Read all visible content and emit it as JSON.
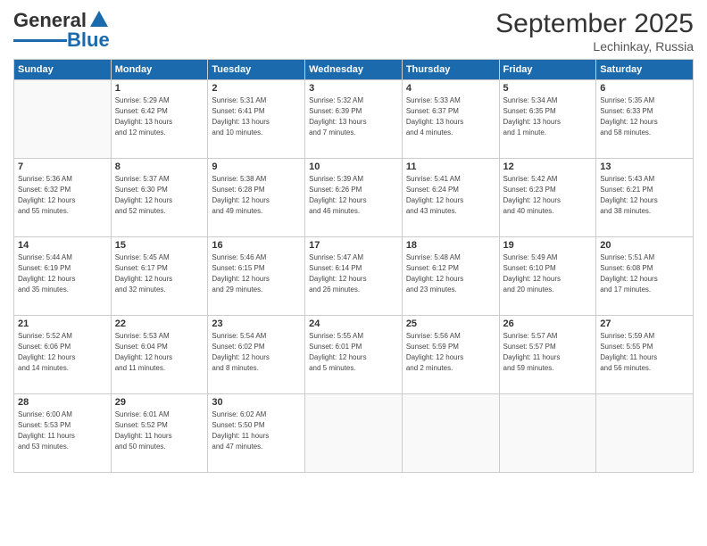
{
  "header": {
    "logo_general": "General",
    "logo_blue": "Blue",
    "month": "September 2025",
    "location": "Lechinkay, Russia"
  },
  "days_of_week": [
    "Sunday",
    "Monday",
    "Tuesday",
    "Wednesday",
    "Thursday",
    "Friday",
    "Saturday"
  ],
  "weeks": [
    [
      {
        "day": "",
        "info": ""
      },
      {
        "day": "1",
        "info": "Sunrise: 5:29 AM\nSunset: 6:42 PM\nDaylight: 13 hours\nand 12 minutes."
      },
      {
        "day": "2",
        "info": "Sunrise: 5:31 AM\nSunset: 6:41 PM\nDaylight: 13 hours\nand 10 minutes."
      },
      {
        "day": "3",
        "info": "Sunrise: 5:32 AM\nSunset: 6:39 PM\nDaylight: 13 hours\nand 7 minutes."
      },
      {
        "day": "4",
        "info": "Sunrise: 5:33 AM\nSunset: 6:37 PM\nDaylight: 13 hours\nand 4 minutes."
      },
      {
        "day": "5",
        "info": "Sunrise: 5:34 AM\nSunset: 6:35 PM\nDaylight: 13 hours\nand 1 minute."
      },
      {
        "day": "6",
        "info": "Sunrise: 5:35 AM\nSunset: 6:33 PM\nDaylight: 12 hours\nand 58 minutes."
      }
    ],
    [
      {
        "day": "7",
        "info": "Sunrise: 5:36 AM\nSunset: 6:32 PM\nDaylight: 12 hours\nand 55 minutes."
      },
      {
        "day": "8",
        "info": "Sunrise: 5:37 AM\nSunset: 6:30 PM\nDaylight: 12 hours\nand 52 minutes."
      },
      {
        "day": "9",
        "info": "Sunrise: 5:38 AM\nSunset: 6:28 PM\nDaylight: 12 hours\nand 49 minutes."
      },
      {
        "day": "10",
        "info": "Sunrise: 5:39 AM\nSunset: 6:26 PM\nDaylight: 12 hours\nand 46 minutes."
      },
      {
        "day": "11",
        "info": "Sunrise: 5:41 AM\nSunset: 6:24 PM\nDaylight: 12 hours\nand 43 minutes."
      },
      {
        "day": "12",
        "info": "Sunrise: 5:42 AM\nSunset: 6:23 PM\nDaylight: 12 hours\nand 40 minutes."
      },
      {
        "day": "13",
        "info": "Sunrise: 5:43 AM\nSunset: 6:21 PM\nDaylight: 12 hours\nand 38 minutes."
      }
    ],
    [
      {
        "day": "14",
        "info": "Sunrise: 5:44 AM\nSunset: 6:19 PM\nDaylight: 12 hours\nand 35 minutes."
      },
      {
        "day": "15",
        "info": "Sunrise: 5:45 AM\nSunset: 6:17 PM\nDaylight: 12 hours\nand 32 minutes."
      },
      {
        "day": "16",
        "info": "Sunrise: 5:46 AM\nSunset: 6:15 PM\nDaylight: 12 hours\nand 29 minutes."
      },
      {
        "day": "17",
        "info": "Sunrise: 5:47 AM\nSunset: 6:14 PM\nDaylight: 12 hours\nand 26 minutes."
      },
      {
        "day": "18",
        "info": "Sunrise: 5:48 AM\nSunset: 6:12 PM\nDaylight: 12 hours\nand 23 minutes."
      },
      {
        "day": "19",
        "info": "Sunrise: 5:49 AM\nSunset: 6:10 PM\nDaylight: 12 hours\nand 20 minutes."
      },
      {
        "day": "20",
        "info": "Sunrise: 5:51 AM\nSunset: 6:08 PM\nDaylight: 12 hours\nand 17 minutes."
      }
    ],
    [
      {
        "day": "21",
        "info": "Sunrise: 5:52 AM\nSunset: 6:06 PM\nDaylight: 12 hours\nand 14 minutes."
      },
      {
        "day": "22",
        "info": "Sunrise: 5:53 AM\nSunset: 6:04 PM\nDaylight: 12 hours\nand 11 minutes."
      },
      {
        "day": "23",
        "info": "Sunrise: 5:54 AM\nSunset: 6:02 PM\nDaylight: 12 hours\nand 8 minutes."
      },
      {
        "day": "24",
        "info": "Sunrise: 5:55 AM\nSunset: 6:01 PM\nDaylight: 12 hours\nand 5 minutes."
      },
      {
        "day": "25",
        "info": "Sunrise: 5:56 AM\nSunset: 5:59 PM\nDaylight: 12 hours\nand 2 minutes."
      },
      {
        "day": "26",
        "info": "Sunrise: 5:57 AM\nSunset: 5:57 PM\nDaylight: 11 hours\nand 59 minutes."
      },
      {
        "day": "27",
        "info": "Sunrise: 5:59 AM\nSunset: 5:55 PM\nDaylight: 11 hours\nand 56 minutes."
      }
    ],
    [
      {
        "day": "28",
        "info": "Sunrise: 6:00 AM\nSunset: 5:53 PM\nDaylight: 11 hours\nand 53 minutes."
      },
      {
        "day": "29",
        "info": "Sunrise: 6:01 AM\nSunset: 5:52 PM\nDaylight: 11 hours\nand 50 minutes."
      },
      {
        "day": "30",
        "info": "Sunrise: 6:02 AM\nSunset: 5:50 PM\nDaylight: 11 hours\nand 47 minutes."
      },
      {
        "day": "",
        "info": ""
      },
      {
        "day": "",
        "info": ""
      },
      {
        "day": "",
        "info": ""
      },
      {
        "day": "",
        "info": ""
      }
    ]
  ]
}
